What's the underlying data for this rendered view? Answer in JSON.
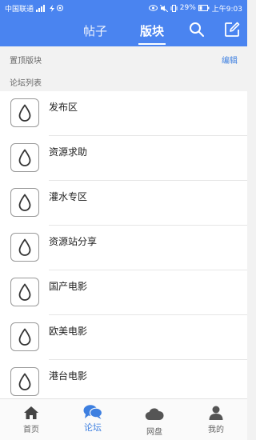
{
  "status_bar": {
    "carrier": "中国联通",
    "battery": "29%",
    "time": "上午9:03"
  },
  "header": {
    "tabs": [
      {
        "label": "帖子",
        "active": false
      },
      {
        "label": "版块",
        "active": true
      }
    ],
    "accent_color": "#4a84f0"
  },
  "pinned_section": {
    "title": "置顶版块",
    "edit_label": "编辑"
  },
  "forum_section": {
    "title": "论坛列表"
  },
  "forums": [
    {
      "label": "发布区"
    },
    {
      "label": "资源求助"
    },
    {
      "label": "灌水专区"
    },
    {
      "label": "资源站分享"
    },
    {
      "label": "国产电影"
    },
    {
      "label": "欧美电影"
    },
    {
      "label": "港台电影"
    }
  ],
  "bottom_nav": [
    {
      "label": "首页",
      "icon": "home-icon",
      "active": false
    },
    {
      "label": "论坛",
      "icon": "chat-bubbles-icon",
      "active": true
    },
    {
      "label": "网盘",
      "icon": "cloud-icon",
      "active": false
    },
    {
      "label": "我的",
      "icon": "person-icon",
      "active": false
    }
  ]
}
